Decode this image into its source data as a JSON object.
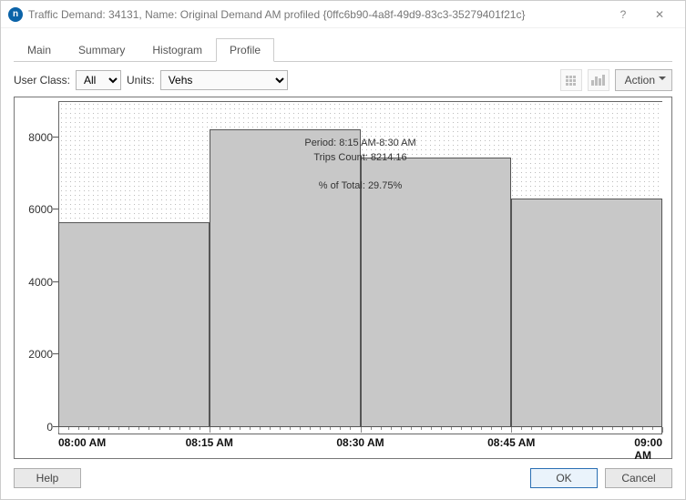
{
  "window": {
    "app_icon_letter": "n",
    "title": "Traffic Demand: 34131, Name: Original Demand AM profiled  {0ffc6b90-4a8f-49d9-83c3-35279401f21c}",
    "help_glyph": "?",
    "close_glyph": "✕"
  },
  "tabs": {
    "items": [
      "Main",
      "Summary",
      "Histogram",
      "Profile"
    ],
    "active_index": 3
  },
  "toolbar": {
    "user_class_label": "User Class:",
    "user_class_value": "All",
    "units_label": "Units:",
    "units_value": "Vehs",
    "action_label": "Action"
  },
  "tooltip": {
    "line1": "Period: 8:15 AM-8:30 AM",
    "line2": "Trips Count: 8214.16",
    "line3": "% of Total: 29.75%"
  },
  "footer": {
    "help": "Help",
    "ok": "OK",
    "cancel": "Cancel"
  },
  "chart_data": {
    "type": "bar",
    "title": "",
    "xlabel": "",
    "ylabel": "",
    "ylim": [
      0,
      9000
    ],
    "yticks": [
      0,
      2000,
      4000,
      6000,
      8000
    ],
    "categories": [
      "08:00 AM",
      "08:15 AM",
      "08:30 AM",
      "08:45 AM",
      "09:00 AM"
    ],
    "values": [
      5650,
      8214.16,
      7450,
      6300
    ],
    "colors": {
      "bar_fill": "#c8c8c8",
      "bar_stroke": "#555555"
    }
  }
}
